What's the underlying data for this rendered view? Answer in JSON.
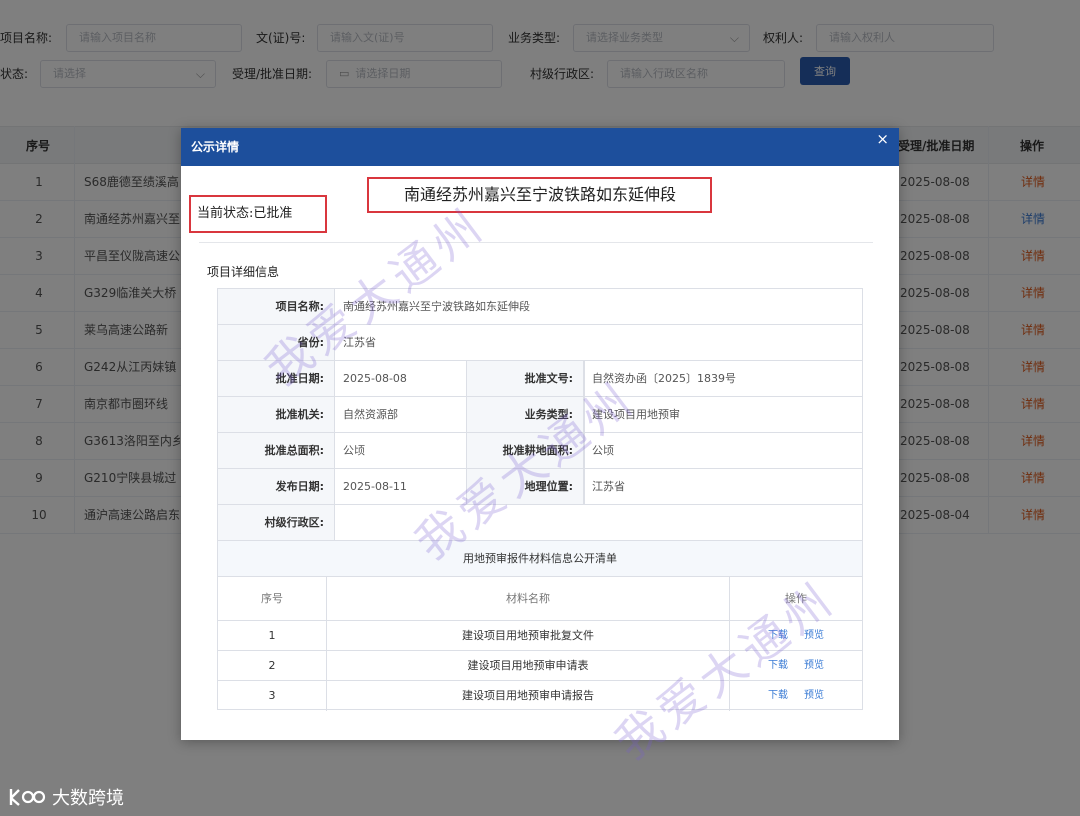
{
  "filters": {
    "project_name_label": "项目名称:",
    "project_name_placeholder": "请输入项目名称",
    "doc_no_label": "文(证)号:",
    "doc_no_placeholder": "请输入文(证)号",
    "biz_type_label": "业务类型:",
    "biz_type_placeholder": "请选择业务类型",
    "owner_label": "权利人:",
    "owner_placeholder": "请输入权利人",
    "status_label": "状态:",
    "status_placeholder": "请选择",
    "date_label": "受理/批准日期:",
    "date_placeholder": "请选择日期",
    "region_label": "村级行政区:",
    "region_placeholder": "请输入行政区名称",
    "query_button": "查询"
  },
  "table": {
    "col_no": "序号",
    "col_date": "受理/批准日期",
    "col_op": "操作",
    "rows": [
      {
        "no": "1",
        "name": "S68鹿德至绩溪高",
        "date": "2025-08-08",
        "op": "详情"
      },
      {
        "no": "2",
        "name": "南通经苏州嘉兴至",
        "date": "2025-08-08",
        "op": "详情"
      },
      {
        "no": "3",
        "name": "平昌至仪陇高速公",
        "date": "2025-08-08",
        "op": "详情"
      },
      {
        "no": "4",
        "name": "G329临淮关大桥",
        "date": "2025-08-08",
        "op": "详情"
      },
      {
        "no": "5",
        "name": "莱乌高速公路新",
        "date": "2025-08-08",
        "op": "详情"
      },
      {
        "no": "6",
        "name": "G242从江丙妹镇",
        "date": "2025-08-08",
        "op": "详情"
      },
      {
        "no": "7",
        "name": "南京都市圈环线",
        "date": "2025-08-08",
        "op": "详情"
      },
      {
        "no": "8",
        "name": "G3613洛阳至内乡",
        "date": "2025-08-08",
        "op": "详情"
      },
      {
        "no": "9",
        "name": "G210宁陕县城过",
        "date": "2025-08-08",
        "op": "详情"
      },
      {
        "no": "10",
        "name": "通沪高速公路启东",
        "date": "2025-08-04",
        "op": "详情"
      }
    ]
  },
  "modal": {
    "title": "公示详情",
    "close": "×",
    "project_title": "南通经苏州嘉兴至宁波铁路如东延伸段",
    "status": "当前状态:已批准",
    "section_title": "项目详细信息",
    "details": {
      "name_label": "项目名称:",
      "name_value": "南通经苏州嘉兴至宁波铁路如东延伸段",
      "province_label": "省份:",
      "province_value": "江苏省",
      "approve_date_label": "批准日期:",
      "approve_date_value": "2025-08-08",
      "approve_no_label": "批准文号:",
      "approve_no_value": "自然资办函〔2025〕1839号",
      "authority_label": "批准机关:",
      "authority_value": "自然资源部",
      "biz_type_label": "业务类型:",
      "biz_type_value": "建设项目用地预审",
      "total_area_label": "批准总面积:",
      "total_area_value": "公顷",
      "farmland_label": "批准耕地面积:",
      "farmland_value": "公顷",
      "publish_date_label": "发布日期:",
      "publish_date_value": "2025-08-11",
      "location_label": "地理位置:",
      "location_value": "江苏省",
      "village_label": "村级行政区:",
      "village_value": ""
    },
    "materials": {
      "title": "用地预审报件材料信息公开清单",
      "col_no": "序号",
      "col_name": "材料名称",
      "col_op": "操作",
      "download": "下载",
      "preview": "预览",
      "rows": [
        {
          "no": "1",
          "name": "建设项目用地预审批复文件"
        },
        {
          "no": "2",
          "name": "建设项目用地预审申请表"
        },
        {
          "no": "3",
          "name": "建设项目用地预审申请报告"
        }
      ]
    }
  },
  "watermark": "我爱大通州",
  "logo_text": "大数跨境"
}
